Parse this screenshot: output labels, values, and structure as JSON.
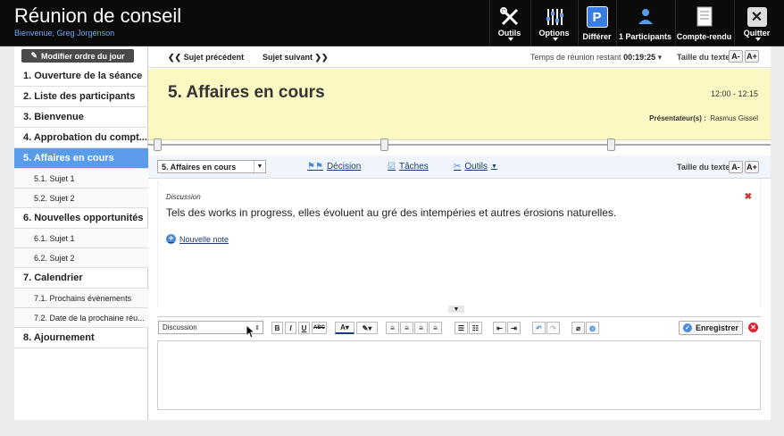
{
  "app": {
    "title": "Réunion de conseil",
    "welcome": "Bienvenue, Greg Jorgenson"
  },
  "toolbar": {
    "tools": "Outils",
    "options": "Options",
    "defer": "Différer",
    "defer_icon_letter": "P",
    "participants": "1 Participants",
    "minutes": "Compte-rendu",
    "quit": "Quitter"
  },
  "sidebar": {
    "modify_label": "Modifier ordre du jour",
    "items": [
      {
        "label": "1. Ouverture de la séance",
        "level": 1,
        "active": false
      },
      {
        "label": "2. Liste des participants",
        "level": 1,
        "active": false
      },
      {
        "label": "3. Bienvenue",
        "level": 1,
        "active": false
      },
      {
        "label": "4. Approbation du compt...",
        "level": 1,
        "active": false
      },
      {
        "label": "5. Affaires en cours",
        "level": 1,
        "active": true
      },
      {
        "label": "5.1. Sujet 1",
        "level": 2,
        "active": false
      },
      {
        "label": "5.2. Sujet 2",
        "level": 2,
        "active": false
      },
      {
        "label": "6. Nouvelles opportunités",
        "level": 1,
        "active": false
      },
      {
        "label": "6.1. Sujet 1",
        "level": 2,
        "active": false
      },
      {
        "label": "6.2. Sujet 2",
        "level": 2,
        "active": false
      },
      {
        "label": "7. Calendrier",
        "level": 1,
        "active": false
      },
      {
        "label": "7.1. Prochains évènements",
        "level": 2,
        "active": false
      },
      {
        "label": "7.2. Date de la prochaine réu...",
        "level": 2,
        "active": false
      },
      {
        "label": "8. Ajournement",
        "level": 1,
        "active": false
      }
    ]
  },
  "nav": {
    "prev": "Sujet précédent",
    "next": "Sujet suivant",
    "timer_label": "Temps de réunion restant",
    "timer_value": "00:19:25",
    "text_size": "Taille du texte",
    "decrease": "A-",
    "increase": "A+"
  },
  "topic": {
    "title": "5. Affaires en cours",
    "time": "12:00 - 12:15",
    "presenter_label": "Présentateur(s) :",
    "presenter": "Rasmus Gissel"
  },
  "topic_toolbar": {
    "selected_topic": "5. Affaires en cours",
    "decision": "Décision",
    "tasks": "Tâches",
    "tools": "Outils",
    "text_size": "Taille du texte",
    "decrease": "A-",
    "increase": "A+"
  },
  "discussion": {
    "label": "Discussion",
    "text": "Tels des works in progress, elles évoluent au gré des intempéries et autres érosions naturelles.",
    "new_note": "Nouvelle note"
  },
  "editor": {
    "style_value": "Discussion",
    "bold": "B",
    "italic": "I",
    "underline": "U",
    "strike": "ABC",
    "font_color": "A",
    "save": "Enregistrer"
  },
  "colors": {
    "accent": "#5a9bea",
    "header_bg": "#fbf8c4",
    "topbar": "#0b0b0b",
    "link": "#1a3d7a",
    "danger": "#dd2233"
  }
}
